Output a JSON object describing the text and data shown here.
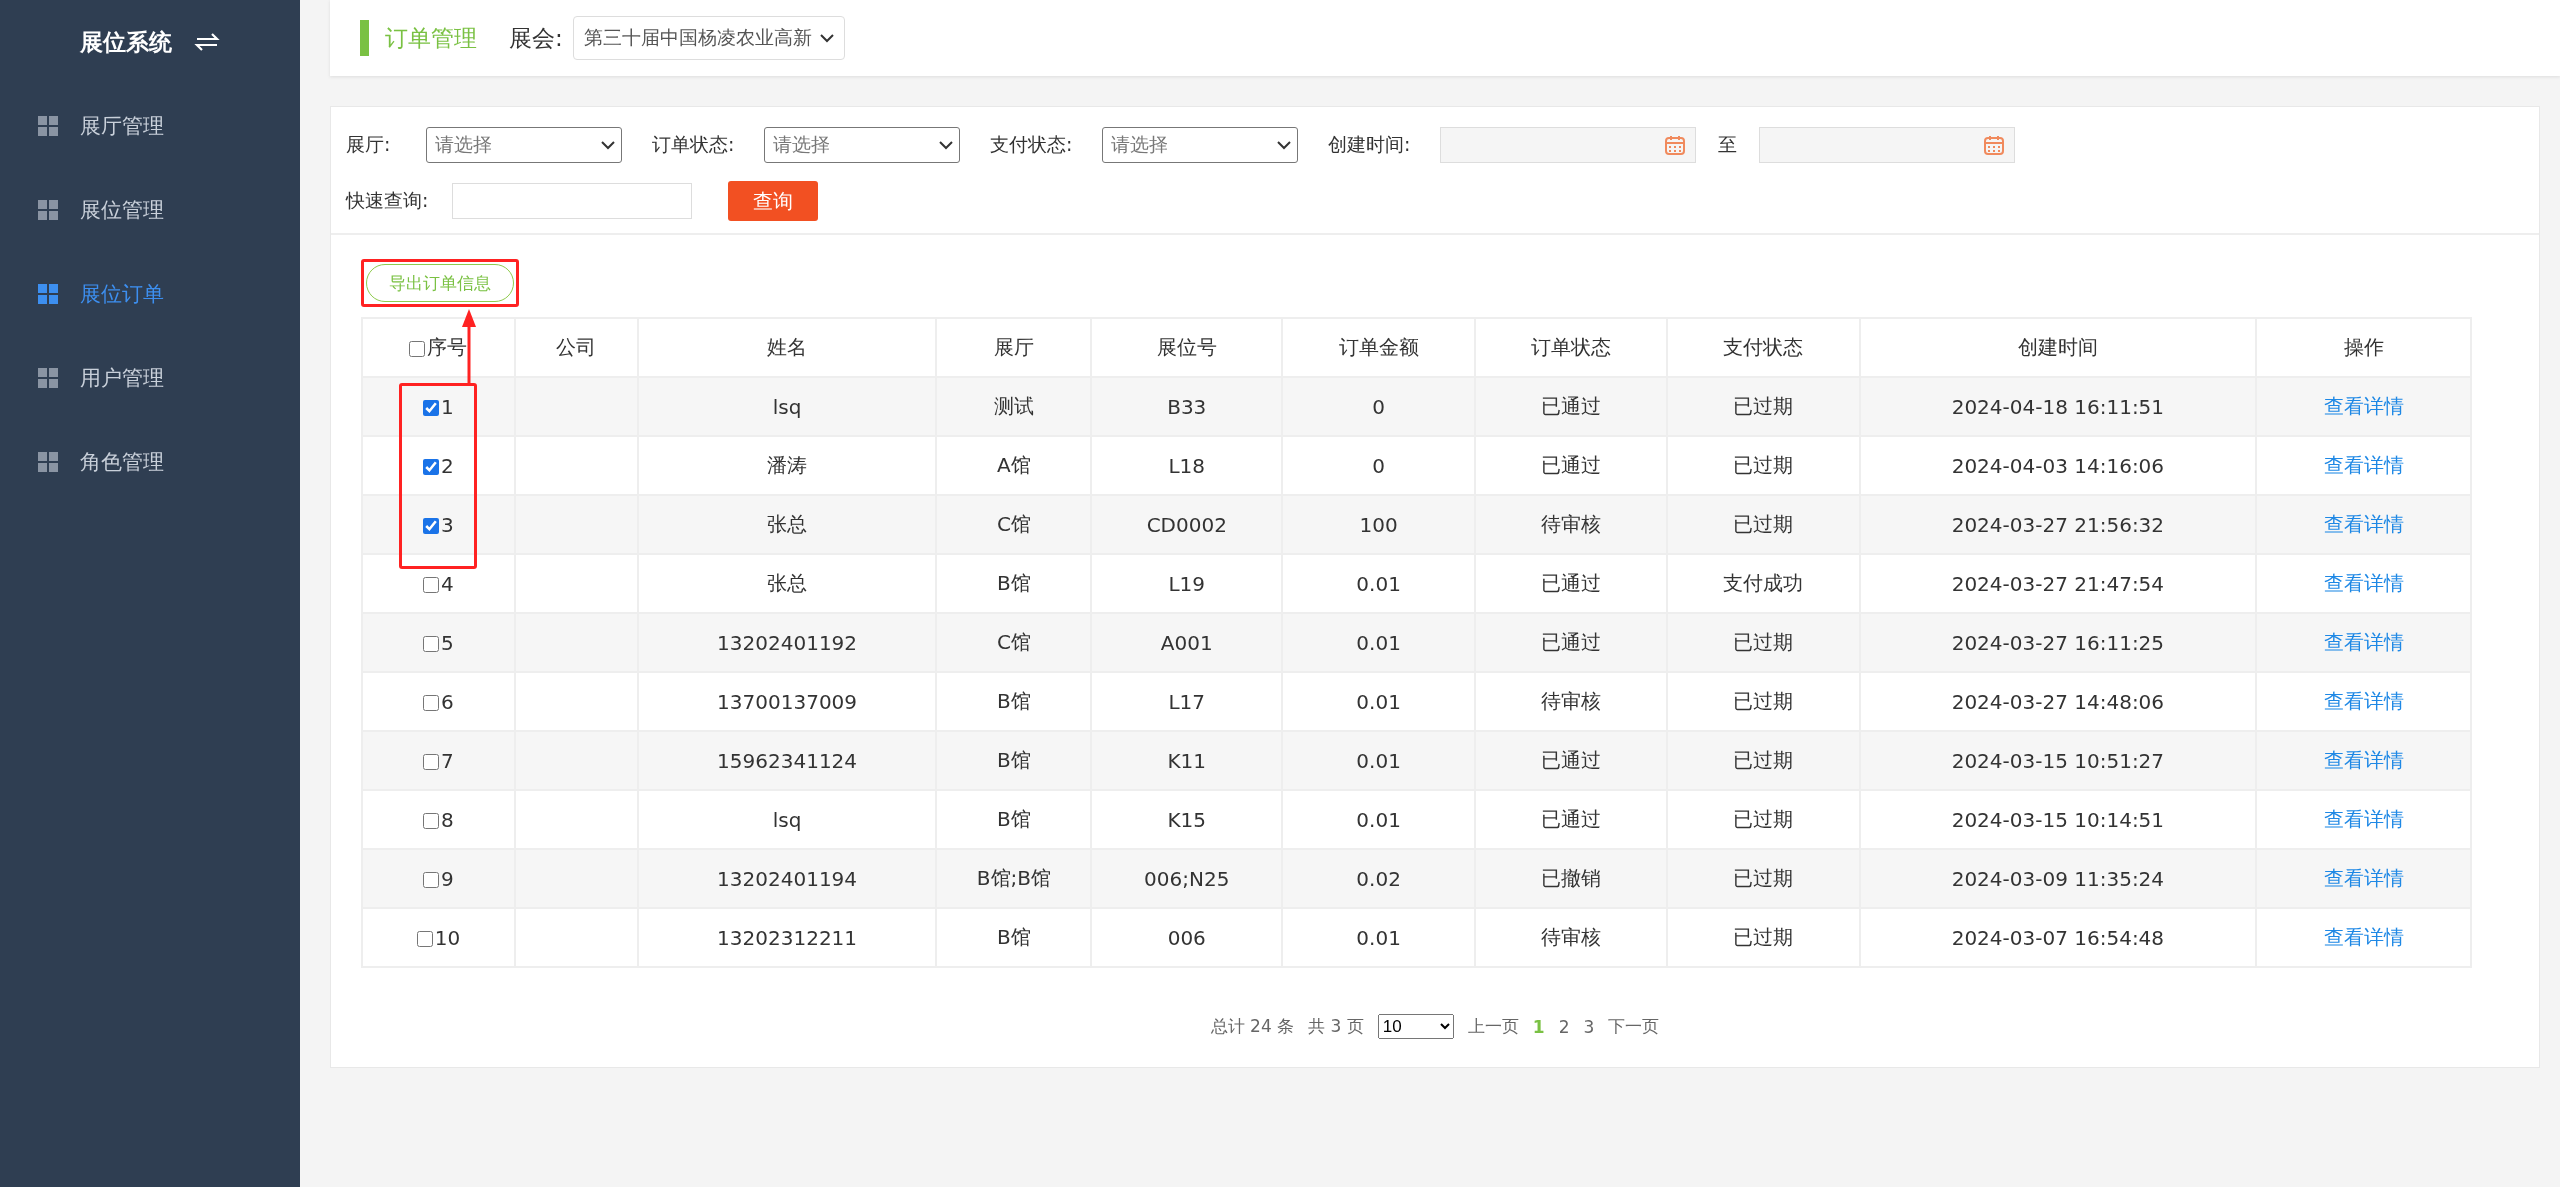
{
  "sidebar": {
    "title": "展位系统",
    "items": [
      {
        "label": "展厅管理",
        "selected": false
      },
      {
        "label": "展位管理",
        "selected": false
      },
      {
        "label": "展位订单",
        "selected": true
      },
      {
        "label": "用户管理",
        "selected": false
      },
      {
        "label": "角色管理",
        "selected": false
      }
    ]
  },
  "header": {
    "title": "订单管理",
    "expo_label": "展会:",
    "expo_value": "第三十届中国杨凌农业高新"
  },
  "filters": [
    {
      "kind": "select",
      "label": "展厅:",
      "placeholder": "请选择"
    },
    {
      "kind": "select",
      "label": "订单状态:",
      "placeholder": "请选择"
    },
    {
      "kind": "select",
      "label": "支付状态:",
      "placeholder": "请选择"
    },
    {
      "kind": "date",
      "label": "创建时间:",
      "separator": "至"
    }
  ],
  "quick_search": {
    "label": "快速查询:",
    "button": "查询"
  },
  "export_button": "导出订单信息",
  "table": {
    "columns": [
      "序号",
      "公司",
      "姓名",
      "展厅",
      "展位号",
      "订单金额",
      "订单状态",
      "支付状态",
      "创建时间",
      "操作"
    ],
    "select_all": false,
    "rows": [
      {
        "checked": true,
        "no": "1",
        "company": "",
        "name": "lsq",
        "hall": "测试",
        "booth": "B33",
        "amount": "0",
        "order_status": "已通过",
        "pay_status": "已过期",
        "created": "2024-04-18 16:11:51",
        "action": "查看详情"
      },
      {
        "checked": true,
        "no": "2",
        "company": "",
        "name": "潘涛",
        "hall": "A馆",
        "booth": "L18",
        "amount": "0",
        "order_status": "已通过",
        "pay_status": "已过期",
        "created": "2024-04-03 14:16:06",
        "action": "查看详情"
      },
      {
        "checked": true,
        "no": "3",
        "company": "",
        "name": "张总",
        "hall": "C馆",
        "booth": "CD0002",
        "amount": "100",
        "order_status": "待审核",
        "pay_status": "已过期",
        "created": "2024-03-27 21:56:32",
        "action": "查看详情"
      },
      {
        "checked": false,
        "no": "4",
        "company": "",
        "name": "张总",
        "hall": "B馆",
        "booth": "L19",
        "amount": "0.01",
        "order_status": "已通过",
        "pay_status": "支付成功",
        "created": "2024-03-27 21:47:54",
        "action": "查看详情"
      },
      {
        "checked": false,
        "no": "5",
        "company": "",
        "name": "13202401192",
        "hall": "C馆",
        "booth": "A001",
        "amount": "0.01",
        "order_status": "已通过",
        "pay_status": "已过期",
        "created": "2024-03-27 16:11:25",
        "action": "查看详情"
      },
      {
        "checked": false,
        "no": "6",
        "company": "",
        "name": "13700137009",
        "hall": "B馆",
        "booth": "L17",
        "amount": "0.01",
        "order_status": "待审核",
        "pay_status": "已过期",
        "created": "2024-03-27 14:48:06",
        "action": "查看详情"
      },
      {
        "checked": false,
        "no": "7",
        "company": "",
        "name": "15962341124",
        "hall": "B馆",
        "booth": "K11",
        "amount": "0.01",
        "order_status": "已通过",
        "pay_status": "已过期",
        "created": "2024-03-15 10:51:27",
        "action": "查看详情"
      },
      {
        "checked": false,
        "no": "8",
        "company": "",
        "name": "lsq",
        "hall": "B馆",
        "booth": "K15",
        "amount": "0.01",
        "order_status": "已通过",
        "pay_status": "已过期",
        "created": "2024-03-15 10:14:51",
        "action": "查看详情"
      },
      {
        "checked": false,
        "no": "9",
        "company": "",
        "name": "13202401194",
        "hall": "B馆;B馆",
        "booth": "006;N25",
        "amount": "0.02",
        "order_status": "已撤销",
        "pay_status": "已过期",
        "created": "2024-03-09 11:35:24",
        "action": "查看详情"
      },
      {
        "checked": false,
        "no": "10",
        "company": "",
        "name": "13202312211",
        "hall": "B馆",
        "booth": "006",
        "amount": "0.01",
        "order_status": "待审核",
        "pay_status": "已过期",
        "created": "2024-03-07 16:54:48",
        "action": "查看详情"
      }
    ]
  },
  "pagination": {
    "total": "总计 24 条",
    "pages": "共 3 页",
    "page_size": "10",
    "prev": "上一页",
    "page_links": [
      {
        "label": "1",
        "selected": true
      },
      {
        "label": "2",
        "selected": false
      },
      {
        "label": "3",
        "selected": false
      }
    ],
    "next": "下一页"
  }
}
